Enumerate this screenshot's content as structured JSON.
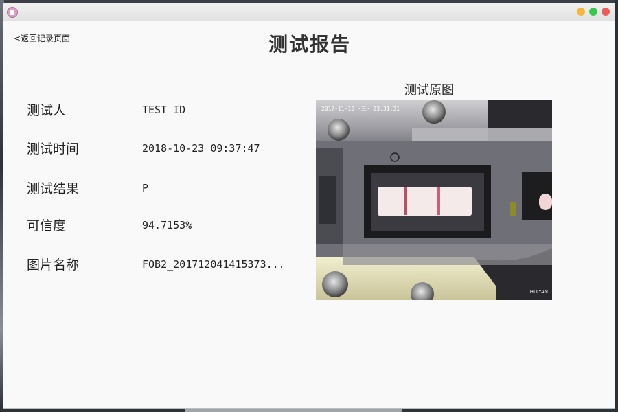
{
  "app": {
    "icon": "app-logo-icon"
  },
  "window_controls": [
    "minimize-button",
    "maximize-button",
    "close-button"
  ],
  "colors": {
    "minimize": "#f4b73a",
    "maximize": "#38c94a",
    "close": "#f05a5a"
  },
  "back_link": "<返回记录页面",
  "page_title": "测试报告",
  "fields": [
    {
      "label": "测试人",
      "value": "TEST ID"
    },
    {
      "label": "测试时间",
      "value": "2018-10-23 09:37:47"
    },
    {
      "label": "测试结果",
      "value": "P"
    },
    {
      "label": "可信度",
      "value": "94.7153%"
    },
    {
      "label": "图片名称",
      "value": "FOB2_201712041415373..."
    }
  ],
  "image_panel": {
    "title": "测试原图",
    "timestamp": "2017-11-10 ·三· 23:31:31",
    "watermark": "HUIYAN"
  }
}
